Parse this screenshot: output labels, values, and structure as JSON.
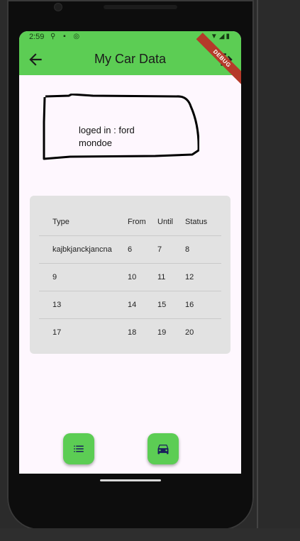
{
  "status_bar": {
    "time": "2:59"
  },
  "app_bar": {
    "title": "My Car Data",
    "debug_banner": "DEBUG"
  },
  "login": {
    "line1": "loged in : ford",
    "line2": "mondoe"
  },
  "table": {
    "headers": [
      "Type",
      "From",
      "Until",
      "Status"
    ],
    "rows": [
      [
        "kajbkjanckjancna",
        "6",
        "7",
        "8"
      ],
      [
        "9",
        "10",
        "11",
        "12"
      ],
      [
        "13",
        "14",
        "15",
        "16"
      ],
      [
        "17",
        "18",
        "19",
        "20"
      ]
    ]
  },
  "fabs": [
    {
      "icon": "list-icon"
    },
    {
      "icon": "car-icon"
    }
  ],
  "colors": {
    "accent": "#5ccd54",
    "background": "#fef7fe",
    "card": "#e2e2e2"
  }
}
